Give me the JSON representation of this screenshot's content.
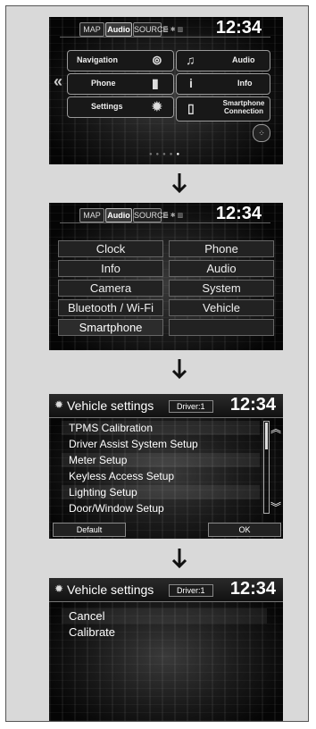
{
  "screen1": {
    "tabs": [
      "MAP",
      "Audio",
      "SOURCE"
    ],
    "active_tab": "Audio",
    "clock": "12:34",
    "buttons": [
      {
        "label": "Navigation",
        "icon": "navigation-icon"
      },
      {
        "label": "Phone",
        "icon": "phone-icon"
      },
      {
        "label": "Settings",
        "icon": "gear-icon"
      },
      {
        "label": "Audio",
        "icon": "music-note-icon"
      },
      {
        "label": "Info",
        "icon": "info-icon"
      },
      {
        "label": "Smartphone Connection",
        "icon": "smartphone-icon"
      }
    ],
    "page_dots": 5,
    "active_dot": 5
  },
  "screen2": {
    "tabs": [
      "MAP",
      "Audio",
      "SOURCE"
    ],
    "active_tab": "Audio",
    "clock": "12:34",
    "menu_left": [
      "Clock",
      "Info",
      "Camera",
      "Bluetooth / Wi-Fi",
      "Smartphone"
    ],
    "menu_right": [
      "Phone",
      "Audio",
      "System",
      "Vehicle",
      ""
    ]
  },
  "screen3": {
    "title": "Vehicle settings",
    "driver": "Driver:1",
    "clock": "12:34",
    "items": [
      "TPMS Calibration",
      "Driver Assist System Setup",
      "Meter Setup",
      "Keyless Access Setup",
      "Lighting Setup",
      "Door/Window Setup"
    ],
    "default_label": "Default",
    "ok_label": "OK"
  },
  "screen4": {
    "title": "Vehicle settings",
    "driver": "Driver:1",
    "clock": "12:34",
    "options": [
      "Cancel",
      "Calibrate"
    ]
  }
}
